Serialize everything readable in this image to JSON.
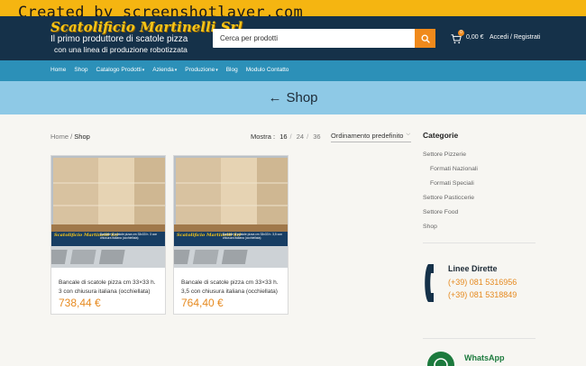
{
  "watermark": "Created by screenshotlayer.com",
  "header": {
    "logo_title": "Scatolificio Martinelli Srl",
    "logo_subtitle_1": "Il primo produttore di scatole pizza",
    "logo_subtitle_2": "con una linea di produzione robotizzata",
    "search_placeholder": "Cerca per prodotti",
    "cart_count": "0",
    "cart_total": "0,00 €",
    "login_label": "Accedi / Registrati"
  },
  "nav": {
    "items": [
      {
        "label": "Home",
        "dropdown": false
      },
      {
        "label": "Shop",
        "dropdown": false
      },
      {
        "label": "Catalogo Prodotti",
        "dropdown": true
      },
      {
        "label": "Azienda",
        "dropdown": true
      },
      {
        "label": "Produzione",
        "dropdown": true
      },
      {
        "label": "Blog",
        "dropdown": false
      },
      {
        "label": "Modulo Contatto",
        "dropdown": false
      }
    ]
  },
  "hero": {
    "title": "Shop",
    "back_arrow": "←"
  },
  "toolbar": {
    "breadcrumb_home": "Home",
    "breadcrumb_sep": "/",
    "breadcrumb_current": "Shop",
    "show_label": "Mostra :",
    "show_options": [
      "16",
      "24",
      "36"
    ],
    "show_sep": "/",
    "sort_value": "Ordinamento predefinito",
    "sort_caret": "⌵"
  },
  "products": [
    {
      "name": "Bancale di scatole pizza cm 33×33 h. 3 con chiusura italiana (occhiellata)",
      "price": "738,44 €",
      "image_banner_title": "Scatolificio Martinelli Srl",
      "image_banner_text": "Bancale di scatole pizza cm 33x33 h. 3 con chiusura italiana (occhiellata)"
    },
    {
      "name": "Bancale di scatole pizza cm 33×33 h. 3,5 con chiusura italiana (occhiellata)",
      "price": "764,40 €",
      "image_banner_title": "Scatolificio Martinelli Srl",
      "image_banner_text": "Bancale di scatole pizza cm 33x33 h. 3,5 con chiusura italiana (occhiellata)"
    }
  ],
  "sidebar": {
    "title": "Categorie",
    "categories": [
      {
        "label": "Settore Pizzerie",
        "sub": false
      },
      {
        "label": "Formati Nazionali",
        "sub": true
      },
      {
        "label": "Formati Speciali",
        "sub": true
      },
      {
        "label": "Settore Pasticcerie",
        "sub": false
      },
      {
        "label": "Settore Food",
        "sub": false
      },
      {
        "label": "Shop",
        "sub": false
      }
    ],
    "phone_title": "Linee Dirette",
    "phones": [
      "(+39) 081 5316956",
      "(+39) 081 5318849"
    ],
    "whatsapp_label": "WhatsApp"
  },
  "colors": {
    "topbar": "#f5b511",
    "header": "#153149",
    "nav": "#2c90b8",
    "hero": "#8ec9e6",
    "accent": "#e68a20",
    "search_button": "#f08a1c",
    "whatsapp": "#1c7a3d"
  },
  "icons": {
    "search": "search-icon",
    "cart": "cart-icon",
    "back": "arrow-left-icon",
    "phone": "phone-icon",
    "whatsapp": "whatsapp-icon"
  }
}
